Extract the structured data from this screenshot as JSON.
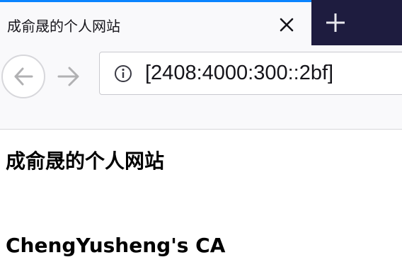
{
  "browser": {
    "tab": {
      "title": "成俞晟的个人网站",
      "close_icon": "close-icon",
      "accent_color": "#0a84ff"
    },
    "new_tab_icon": "plus-icon",
    "tabstrip_color": "#1e1c3f",
    "nav": {
      "back_icon": "arrow-left-icon",
      "forward_icon": "arrow-right-icon"
    },
    "urlbar": {
      "info_icon": "info-icon",
      "url": "[2408:4000:300::2bf]"
    }
  },
  "page": {
    "heading_site": "成俞晟的个人网站",
    "heading_ca": "ChengYusheng's CA"
  }
}
